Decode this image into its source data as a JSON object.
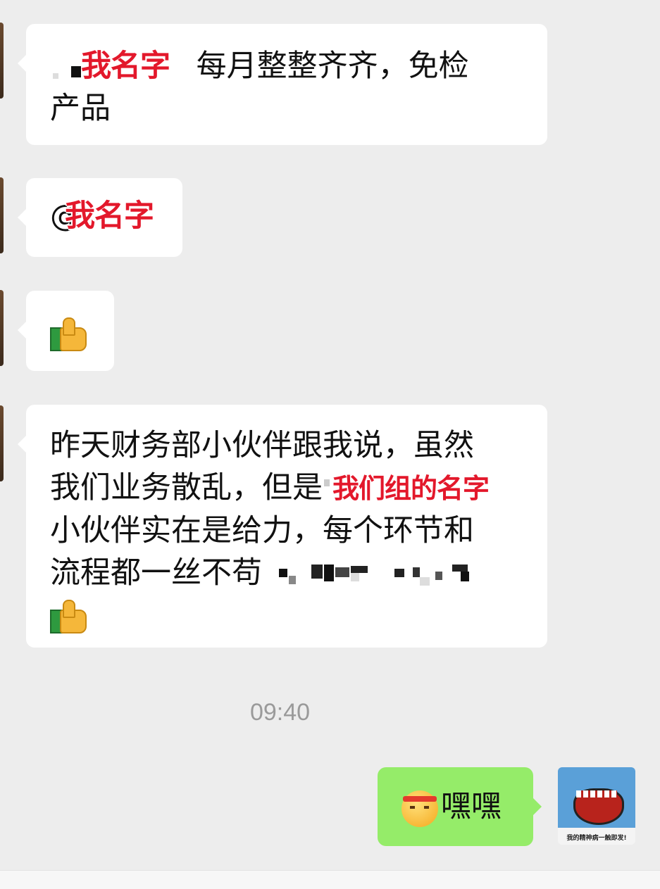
{
  "messages": [
    {
      "id": "m1",
      "line1_prefix": "",
      "redaction_label": "我名字",
      "line1_rest": "每月整整齐齐，免检",
      "line2": "产品"
    },
    {
      "id": "m2",
      "prefix": "@",
      "redaction_label": "我名字"
    },
    {
      "id": "m3",
      "emoji": "thumbs-up"
    },
    {
      "id": "m4",
      "line1": "昨天财务部小伙伴跟我说，虽然",
      "line2_prefix": "我们业务散乱，但是",
      "redaction_label": "我们组的名字",
      "line3": "小伙伴实在是给力，每个环节和",
      "line4": "流程都一丝不苟",
      "trailing_emoji": "thumbs-up"
    }
  ],
  "timestamp": "09:40",
  "my_message": {
    "text": "嘿嘿",
    "emoji": "saluting-face-with-headband"
  },
  "my_avatar": {
    "caption": "我的精神病一触即发!"
  },
  "colors": {
    "background": "#ededed",
    "incoming_bubble": "#ffffff",
    "outgoing_bubble": "#95ec69",
    "redaction_text": "#e3182b",
    "timestamp": "#9a9a9a"
  }
}
